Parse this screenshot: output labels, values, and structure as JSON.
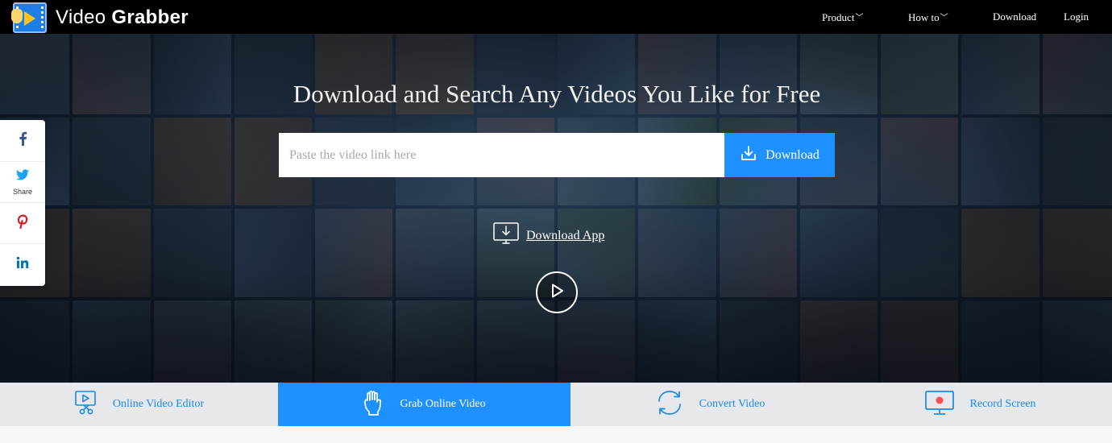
{
  "brand": {
    "name_light": "Video ",
    "name_bold": "Grabber",
    "logo_icon": "video-grabber-logo"
  },
  "nav": {
    "items": [
      {
        "label": "Product",
        "has_caret": true
      },
      {
        "label": "How to",
        "has_caret": true
      },
      {
        "label": "Download",
        "has_caret": false
      },
      {
        "label": "Login",
        "has_caret": false
      }
    ],
    "caret_glyph": "﹀"
  },
  "hero": {
    "headline": "Download and Search Any Videos You Like for Free",
    "search": {
      "placeholder": "Paste the video link here",
      "value": ""
    },
    "download_button": "Download",
    "download_app": "Download App",
    "play_icon": "play-icon"
  },
  "social": [
    {
      "network": "facebook",
      "icon": "facebook-icon",
      "label": ""
    },
    {
      "network": "twitter",
      "icon": "twitter-icon",
      "label": "Share"
    },
    {
      "network": "pinterest",
      "icon": "pinterest-icon",
      "label": ""
    },
    {
      "network": "linkedin",
      "icon": "linkedin-icon",
      "label": ""
    }
  ],
  "tabs": [
    {
      "label": "Online Video Editor",
      "icon": "video-editor-icon",
      "active": false
    },
    {
      "label": "Grab Online Video",
      "icon": "grab-hand-icon",
      "active": true
    },
    {
      "label": "Convert Video",
      "icon": "convert-icon",
      "active": false
    },
    {
      "label": "Record Screen",
      "icon": "record-screen-icon",
      "active": false
    }
  ],
  "colors": {
    "accent": "#1e90ff",
    "topbar": "#000000",
    "tab_bar": "#e6e8eb",
    "tab_text": "#1e88e5",
    "facebook": "#3b5998",
    "twitter": "#1da1f2",
    "pinterest": "#cb2027",
    "linkedin": "#0077b5"
  }
}
